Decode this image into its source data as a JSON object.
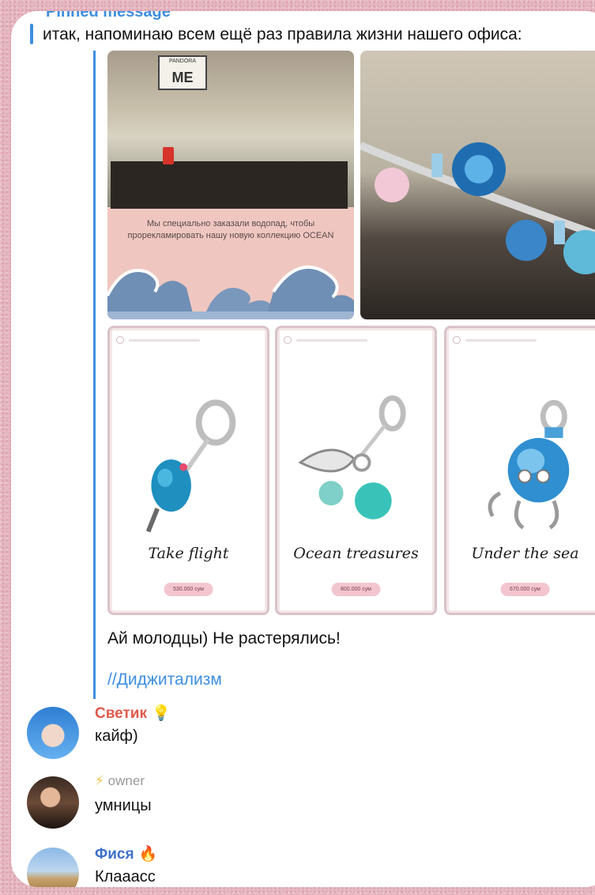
{
  "pinned": {
    "title": "Pinned message",
    "text": "итак, напоминаю всем ещё раз правила жизни нашего офиса:"
  },
  "post": {
    "left_image": {
      "sign_top": "PANDORA",
      "sign_main": "ME",
      "caption": "Мы специально заказали водопад, чтобы прорекламировать нашу новую коллекцию OCEAN"
    },
    "cards": [
      {
        "script": "Take flight",
        "price": "530.000 сум"
      },
      {
        "script": "Ocean treasures",
        "price": "800.000 сум"
      },
      {
        "script": "Under the sea",
        "price": "670.000 сум"
      }
    ],
    "text": "Ай молодцы) Не растерялись!",
    "tag": "//Диджитализм"
  },
  "chat": [
    {
      "sender": "Светик",
      "emoji": "💡",
      "text": "кайф)",
      "color": "#e05a4a"
    },
    {
      "role_icon": "⚡",
      "role": "owner",
      "text": "умницы",
      "color": "#9a9a9a"
    },
    {
      "sender": "Фися",
      "emoji": "🔥",
      "text": "Клааасс",
      "color": "#3d70c9"
    }
  ],
  "colors": {
    "accent": "#3d8ee0",
    "background": "#e6b8c2"
  }
}
